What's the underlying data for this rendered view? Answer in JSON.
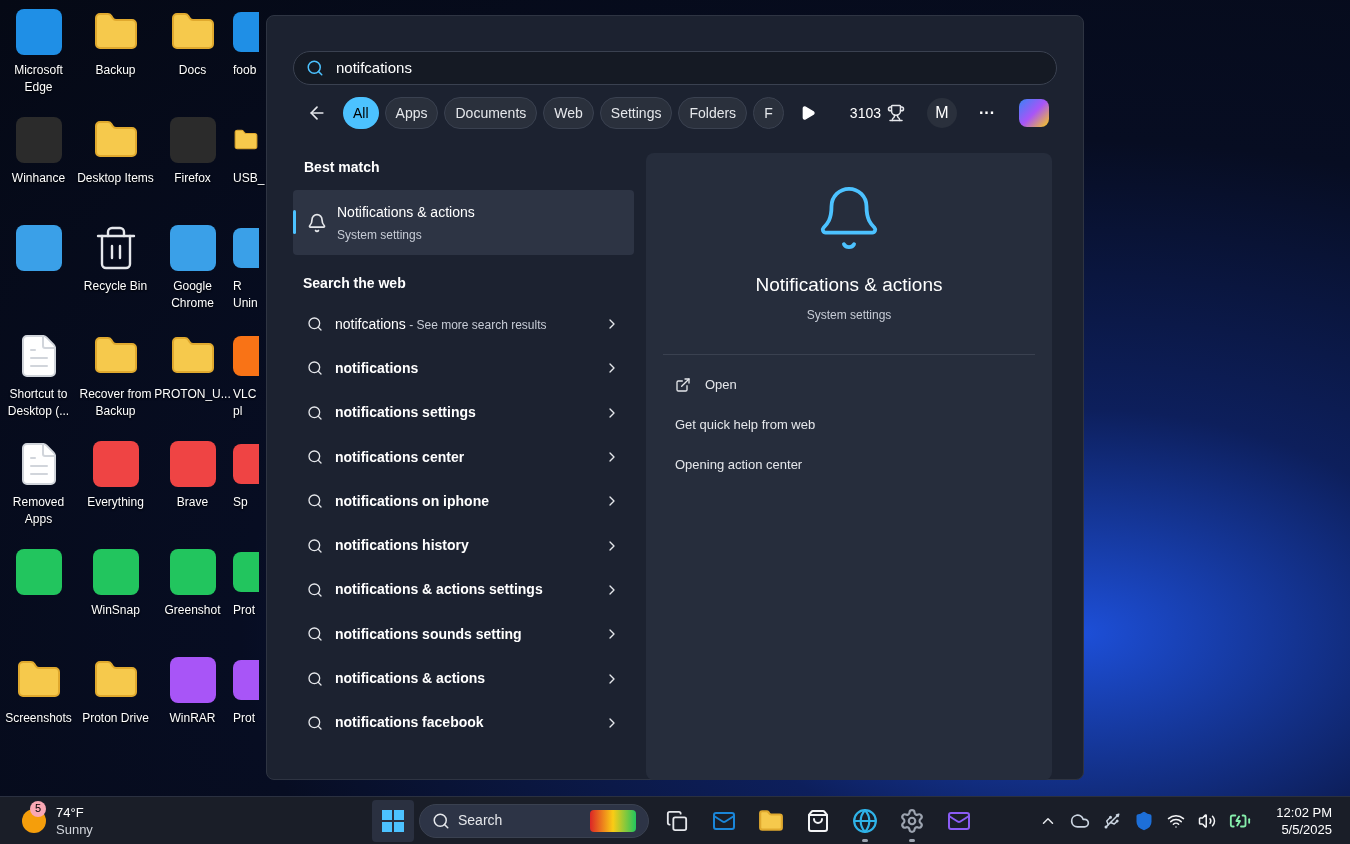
{
  "desktop": {
    "columns": [
      {
        "icons": [
          {
            "label": "Microsoft Edge",
            "kind": "app"
          },
          {
            "label": "Winhance",
            "kind": "app"
          },
          {
            "kind": "app"
          },
          {
            "label": "Shortcut to Desktop (...",
            "kind": "document"
          },
          {
            "label": "Removed Apps",
            "kind": "document"
          },
          {
            "kind": "app"
          },
          {
            "label": "Screenshots",
            "kind": "folder"
          }
        ]
      },
      {
        "icons": [
          {
            "label": "Backup",
            "kind": "folder"
          },
          {
            "label": "Desktop Items",
            "kind": "folder"
          },
          {
            "label": "Recycle Bin",
            "kind": "bin"
          },
          {
            "label": "Recover from Backup",
            "kind": "folder"
          },
          {
            "label": "Everything",
            "kind": "app"
          },
          {
            "label": "WinSnap",
            "kind": "app"
          },
          {
            "label": "Proton Drive",
            "kind": "folder"
          }
        ]
      },
      {
        "icons": [
          {
            "label": "Docs",
            "kind": "folder"
          },
          {
            "label": "Firefox",
            "kind": "app"
          },
          {
            "label": "Google Chrome",
            "kind": "app"
          },
          {
            "label": "PROTON_U...",
            "kind": "folder"
          },
          {
            "label": "Brave",
            "kind": "app"
          },
          {
            "label": "Greenshot",
            "kind": "app"
          },
          {
            "label": "WinRAR",
            "kind": "app"
          }
        ]
      },
      {
        "icons": [
          {
            "label": "foob",
            "kind": "app"
          },
          {
            "label": "USB_",
            "kind": "folder"
          },
          {
            "label": "R Unin",
            "kind": "app"
          },
          {
            "label": "VLC pl",
            "kind": "app"
          },
          {
            "label": "Sp",
            "kind": "app"
          },
          {
            "label": "Prot",
            "kind": "app"
          },
          {
            "label": "Prot",
            "kind": "app"
          }
        ]
      }
    ]
  },
  "search_panel": {
    "query": "notifcations",
    "filters": [
      {
        "label": "All",
        "selected": true
      },
      {
        "label": "Apps",
        "selected": false
      },
      {
        "label": "Documents",
        "selected": false
      },
      {
        "label": "Web",
        "selected": false
      },
      {
        "label": "Settings",
        "selected": false
      },
      {
        "label": "Folders",
        "selected": false
      },
      {
        "label": "F",
        "selected": false
      }
    ],
    "points": "3103",
    "avatar": "M",
    "more": "···",
    "best_match_heading": "Best match",
    "best_match": {
      "title": "Notifications & actions",
      "subtitle": "System settings",
      "selected": true
    },
    "web_heading": "Search the web",
    "web_results": [
      {
        "text": "notifcations",
        "hint": "- See more search results"
      },
      {
        "text": "notifications"
      },
      {
        "text": "notifications settings"
      },
      {
        "text": "notifications center"
      },
      {
        "text": "notifications on iphone"
      },
      {
        "text": "notifications history"
      },
      {
        "text": "notifications & actions settings"
      },
      {
        "text": "notifications sounds setting"
      },
      {
        "text": "notifications & actions"
      },
      {
        "text": "notifications facebook"
      }
    ],
    "detail": {
      "title": "Notifications & actions",
      "subtitle": "System settings",
      "actions": [
        {
          "label": "Open",
          "kind": "open"
        },
        {
          "label": "Get quick help from web",
          "kind": "link"
        },
        {
          "label": "Opening action center",
          "kind": "link"
        }
      ]
    }
  },
  "taskbar": {
    "weather": {
      "badge": "5",
      "temperature": "74°F",
      "condition": "Sunny"
    },
    "search_placeholder": "Search",
    "apps": [
      {
        "kind": "taskview",
        "running": false
      },
      {
        "kind": "mail",
        "running": false
      },
      {
        "kind": "explorer",
        "running": false
      },
      {
        "kind": "store",
        "running": false
      },
      {
        "kind": "browser",
        "running": true
      },
      {
        "kind": "settings",
        "running": true
      },
      {
        "kind": "protonmail",
        "running": false
      }
    ],
    "time": "12:02 PM",
    "date": "5/5/2025"
  }
}
